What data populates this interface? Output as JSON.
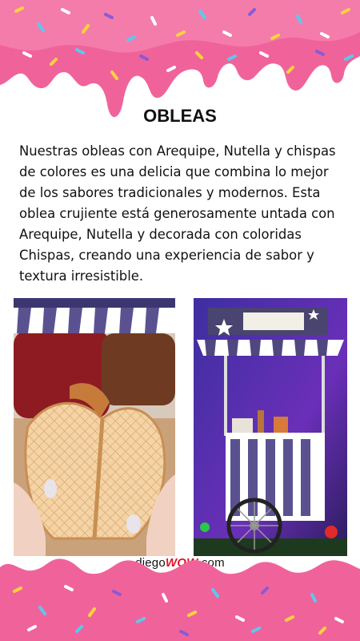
{
  "title": "OBLEAS",
  "description": "Nuestras obleas con Arequipe, Nutella y chispas de colores es una delicia que combina lo mejor de los sabores tradicionales y modernos. Esta oblea crujiente está generosamente untada con Arequipe, Nutella y decorada con coloridas Chispas, creando una experiencia de sabor y textura irresistible.",
  "footer": {
    "brand_prefix": "diego",
    "brand_wow": "WOW",
    "brand_suffix": ".com"
  },
  "colors": {
    "frosting": "#f0639a",
    "frosting_light": "#f78db6",
    "stripe_purple": "#6a5fa0",
    "accent_red": "#e0162b"
  }
}
